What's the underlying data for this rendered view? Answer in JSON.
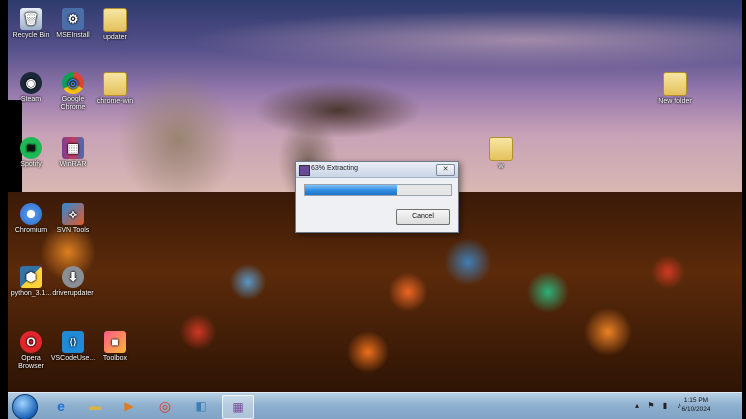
{
  "desktop_icons": [
    {
      "label": "Recycle Bin",
      "icon": "recycle-bin-icon",
      "glyph": "🗑"
    },
    {
      "label": "MSEInstall",
      "icon": "installer-icon",
      "glyph": "⚙"
    },
    {
      "label": "updater",
      "icon": "folder-icon",
      "glyph": ""
    },
    {
      "label": "Steam",
      "icon": "steam-icon",
      "glyph": "◉"
    },
    {
      "label": "Google Chrome",
      "icon": "chrome-icon",
      "glyph": "◎"
    },
    {
      "label": "chrome-win",
      "icon": "folder-icon",
      "glyph": ""
    },
    {
      "label": "New folder",
      "icon": "folder-icon",
      "glyph": ""
    },
    {
      "label": "Spotify",
      "icon": "spotify-icon",
      "glyph": "≋"
    },
    {
      "label": "WinRAR",
      "icon": "winrar-icon",
      "glyph": "▦"
    },
    {
      "label": "w",
      "icon": "folder-icon",
      "glyph": ""
    },
    {
      "label": "Chromium",
      "icon": "chromium-icon",
      "glyph": "◎"
    },
    {
      "label": "SVN Tools",
      "icon": "svn-icon",
      "glyph": "⟡"
    },
    {
      "label": "python_3.1...",
      "icon": "python-icon",
      "glyph": "⬢"
    },
    {
      "label": "driverupdater",
      "icon": "download-icon",
      "glyph": "⬇"
    },
    {
      "label": "Opera Browser",
      "icon": "opera-icon",
      "glyph": "O"
    },
    {
      "label": "VSCodeUse...",
      "icon": "vscode-icon",
      "glyph": "⟨⟩"
    },
    {
      "label": "Toolbox",
      "icon": "toolbox-icon",
      "glyph": "■"
    }
  ],
  "dialog": {
    "title": "63% Extracting",
    "progress": 0.63,
    "cancel_label": "Cancel",
    "close_label": "✕"
  },
  "taskbar": {
    "items": [
      {
        "name": "internet-explorer-icon",
        "glyph": "e",
        "color": "#1e74d6"
      },
      {
        "name": "file-explorer-icon",
        "glyph": "▬",
        "color": "#d8b24a"
      },
      {
        "name": "media-player-icon",
        "glyph": "▶",
        "color": "#e07a1e"
      },
      {
        "name": "chrome-icon",
        "glyph": "◎",
        "color": "#d93b2b"
      },
      {
        "name": "app-window-icon",
        "glyph": "◧",
        "color": "#3b7fb8"
      },
      {
        "name": "winrar-icon",
        "glyph": "▦",
        "color": "#7a4a9a"
      }
    ],
    "time": "1:15 PM",
    "date": "6/10/2024"
  },
  "colors": {
    "progress_fill": "#2f8be0",
    "taskbar": "#8fb0cf"
  }
}
